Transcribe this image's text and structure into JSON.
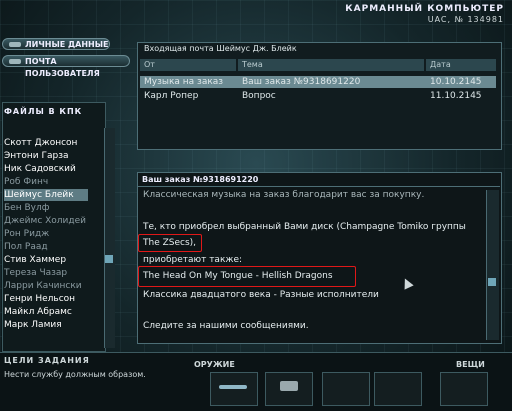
{
  "header": {
    "title": "КАРМАННЫЙ КОМПЬЮТЕР",
    "subtitle": "UAC, № 134981"
  },
  "buttons": {
    "personal": "ЛИЧНЫЕ ДАННЫЕ",
    "mail": "ПОЧТА ПОЛЬЗОВАТЕЛЯ"
  },
  "files": {
    "title": "ФАЙЛЫ В КПК",
    "contacts": [
      "Скотт Джонсон",
      "Энтони Гарза",
      "Ник Садовский",
      "Роб Финч",
      "Шеймус Блейк",
      "Бен Вулф",
      "Джеймс Холидей",
      "Рон Ридж",
      "Пол Раад",
      "Стив Хаммер",
      "Тереза Чазар",
      "Ларри Качински",
      "Генри Нельсон",
      "Майкл Абрамс",
      "Марк Ламия"
    ]
  },
  "inbox": {
    "title": "Входящая почта  Шеймус Дж. Блейк",
    "columns": [
      "От",
      "Тема",
      "Дата"
    ],
    "rows": [
      {
        "from": "Музыка на заказ",
        "subject": "Ваш заказ №9318691220",
        "date": "10.10.2145"
      },
      {
        "from": "Карл Ропер",
        "subject": "Вопрос",
        "date": "11.10.2145"
      }
    ]
  },
  "message": {
    "title": "Ваш заказ №9318691220",
    "lines": [
      "Классическая музыка на заказ благодарит вас за покупку.",
      "Те, кто приобрел выбранный Вами диск (Champagne Tomiko группы",
      "The ZSecs),",
      "приобретают также:",
      "The Head On My Tongue - Hellish Dragons",
      "Классика двадцатого века - Разные исполнители",
      "Следите за нашими сообщениями."
    ]
  },
  "objectives": {
    "title": "ЦЕЛИ ЗАДАНИЯ",
    "text": "Нести службу должным образом."
  },
  "inventory": {
    "weapons": "ОРУЖИЕ",
    "items": "ВЕЩИ"
  },
  "colors": {
    "highlight": "#e01818",
    "selection": "#6b8a92",
    "accent": "#6fa6b8"
  }
}
